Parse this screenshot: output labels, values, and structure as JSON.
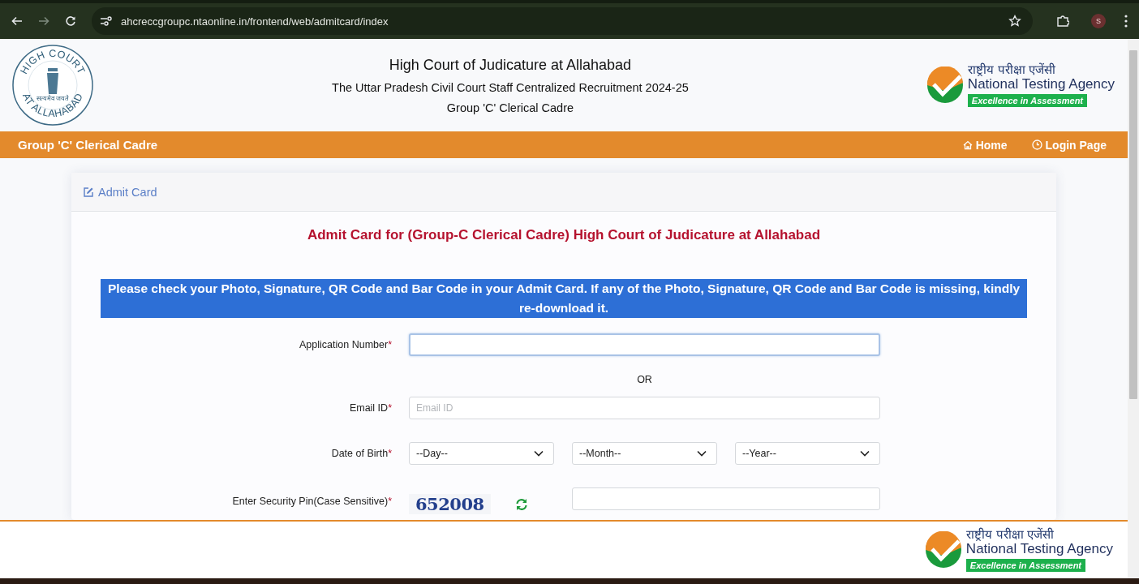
{
  "browser": {
    "url": "ahcreccgroupc.ntaonline.in/frontend/web/admitcard/index",
    "profile_initial": "S"
  },
  "header": {
    "seal": {
      "top_text": "HIGH COURT",
      "motto": "सत्यमेव जयते",
      "bottom_text": "AT ALLAHABAD"
    },
    "title": "High Court of Judicature at Allahabad",
    "subtitle": "The Uttar Pradesh Civil Court Staff Centralized Recruitment 2024-25",
    "group": "Group 'C' Clerical Cadre",
    "nta_logo": {
      "hindi": "राष्ट्रीय परीक्षा एजेंसी",
      "english": "National Testing Agency",
      "tagline": "Excellence in Assessment"
    }
  },
  "nav": {
    "title": "Group 'C' Clerical Cadre",
    "links": [
      {
        "label": "Home",
        "kind": "home"
      },
      {
        "label": "Login Page",
        "kind": "login"
      }
    ]
  },
  "card": {
    "header_title": "Admit Card",
    "heading": "Admit Card for (Group-C Clerical Cadre) High Court of Judicature at Allahabad",
    "notice": {
      "text": "Please check your Photo, Signature, QR Code and Bar Code in your Admit Card. If any of the Photo, Signature, QR Code and Bar Code is missing, kindly re-download it.",
      "highlighted": true
    },
    "form": [
      {
        "kind": "text",
        "label": "Application Number",
        "marker": "*",
        "focused": true
      },
      {
        "kind": "separator",
        "text": "OR"
      },
      {
        "kind": "text",
        "label": "Email ID",
        "marker": "*",
        "placeholder": "Email ID",
        "focused": false
      },
      {
        "kind": "selects",
        "label": "Date of Birth",
        "marker": "*",
        "selects": [
          {
            "value": "--Day--"
          },
          {
            "value": "--Month--"
          },
          {
            "value": "--Year--"
          }
        ]
      },
      {
        "kind": "captcha",
        "label": "Enter Security Pin(Case Sensitive)",
        "marker": "*",
        "code": "652008",
        "focused": false
      }
    ]
  },
  "footer": {
    "nta_logo": {
      "hindi": "राष्ट्रीय परीक्षा एजेंसी",
      "english": "National Testing Agency",
      "tagline": "Excellence in Assessment"
    }
  }
}
